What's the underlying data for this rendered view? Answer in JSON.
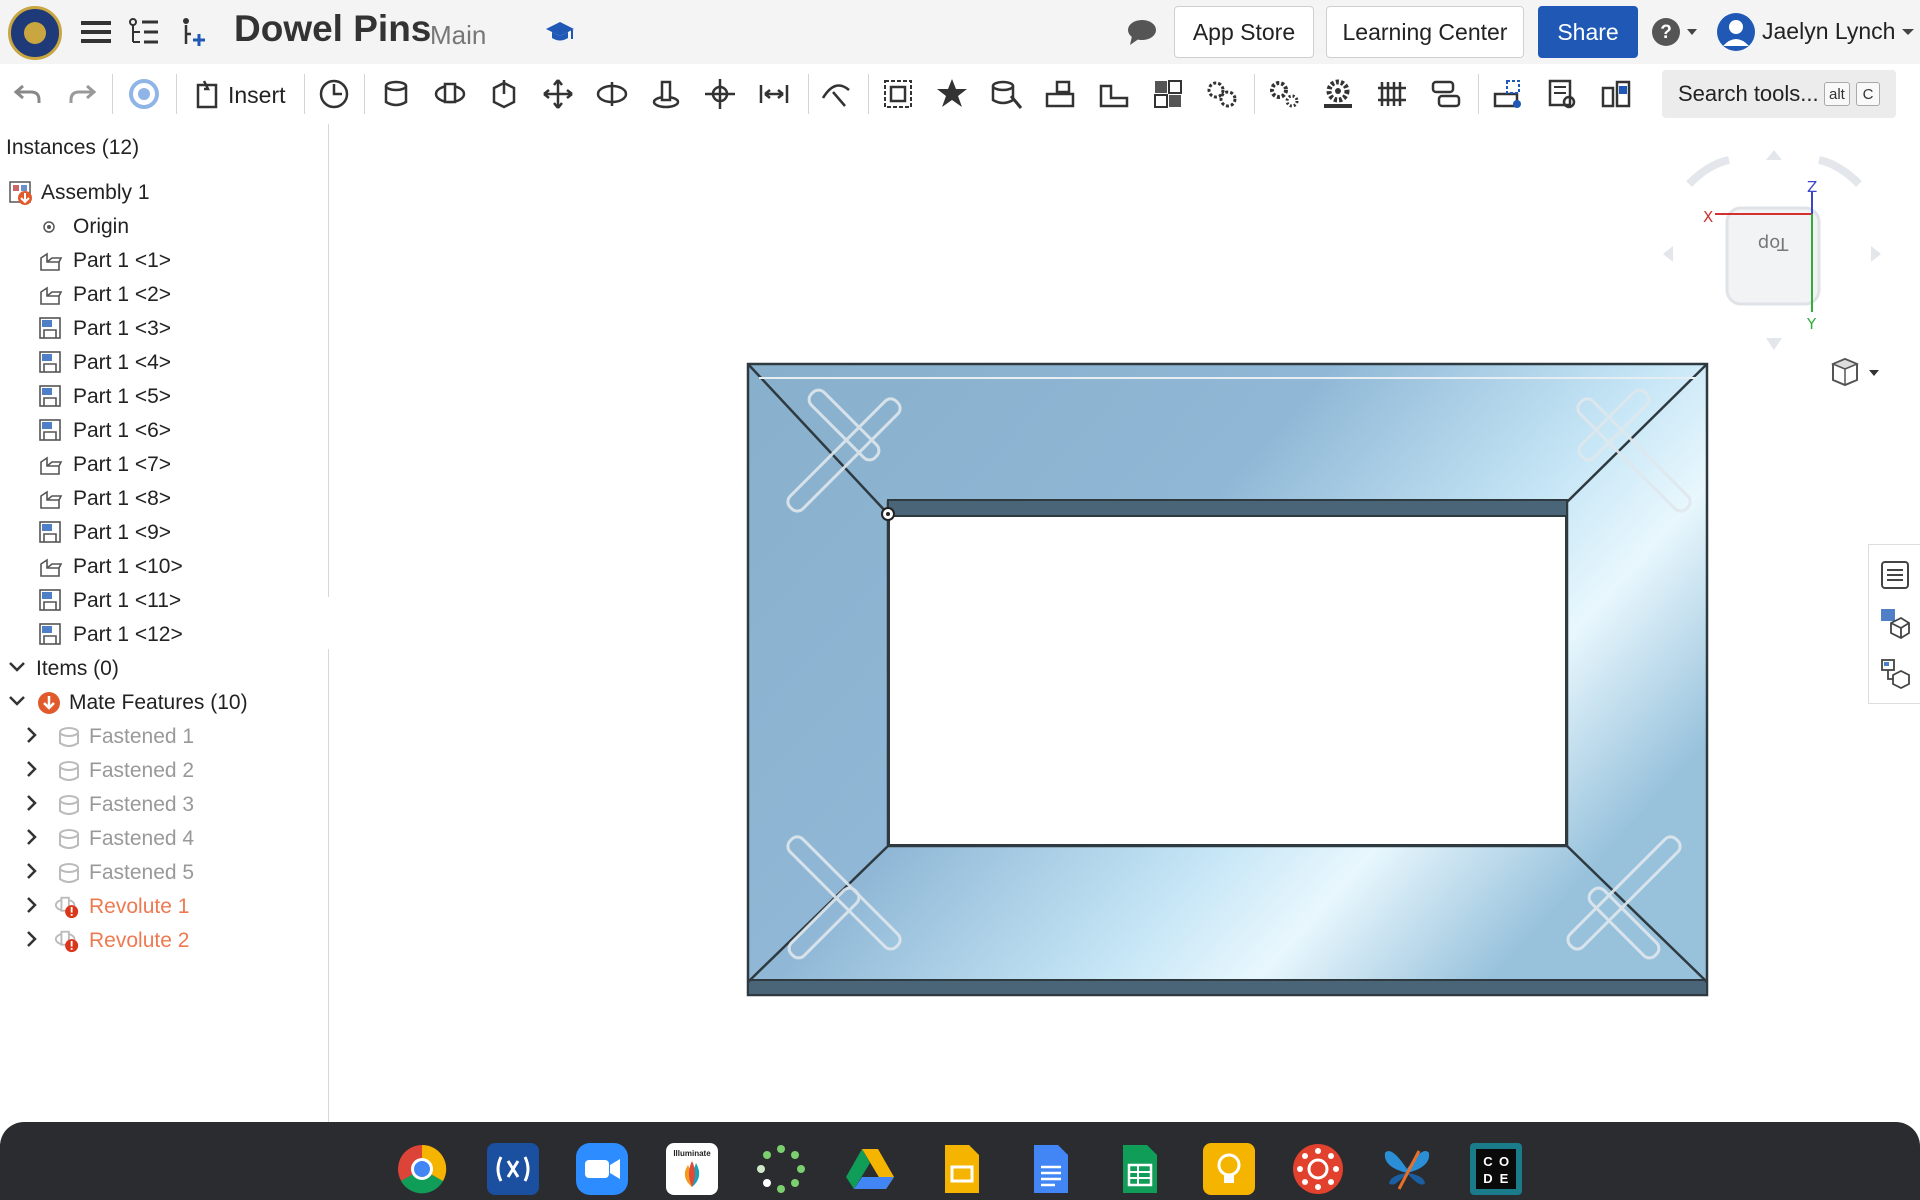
{
  "header": {
    "title": "Dowel Pins",
    "branch": "Main",
    "app_store_label": "App Store",
    "learning_center_label": "Learning Center",
    "share_label": "Share",
    "user_name": "Jaelyn Lynch"
  },
  "toolbar": {
    "insert_label": "Insert",
    "search_label": "Search tools...",
    "search_shortcut_mod": "alt",
    "search_shortcut_key": "C"
  },
  "instances_panel": {
    "title": "Instances (12)",
    "assembly": "Assembly 1",
    "origin": "Origin",
    "parts": [
      "Part 1 <1>",
      "Part 1 <2>",
      "Part 1 <3>",
      "Part 1 <4>",
      "Part 1 <5>",
      "Part 1 <6>",
      "Part 1 <7>",
      "Part 1 <8>",
      "Part 1 <9>",
      "Part 1 <10>",
      "Part 1 <11>",
      "Part 1 <12>"
    ],
    "items_group": "Items (0)",
    "mate_features_group": "Mate Features (10)",
    "mates": [
      {
        "label": "Fastened 1",
        "state": "suppressed"
      },
      {
        "label": "Fastened 2",
        "state": "suppressed"
      },
      {
        "label": "Fastened 3",
        "state": "suppressed"
      },
      {
        "label": "Fastened 4",
        "state": "suppressed"
      },
      {
        "label": "Fastened 5",
        "state": "suppressed"
      },
      {
        "label": "Revolute 1",
        "state": "error"
      },
      {
        "label": "Revolute 2",
        "state": "error"
      }
    ]
  },
  "view_cube": {
    "face_label": "Top",
    "axis_x": "X",
    "axis_y": "Y",
    "axis_z": "Z"
  },
  "colors": {
    "accent": "#1f58b5",
    "frame_fill": "#8ab2cf",
    "frame_edge": "#3f5a6b",
    "error": "#e05a2b",
    "taskbar": "#2b2c30"
  },
  "taskbar": {
    "apps": [
      "chrome-icon",
      "parentsquare-icon",
      "zoom-icon",
      "illuminate-icon",
      "loading-dots-icon",
      "google-drive-icon",
      "google-slides-icon",
      "google-docs-icon",
      "google-sheets-icon",
      "google-keep-icon",
      "canvas-icon",
      "butterfly-app-icon",
      "code-org-icon"
    ],
    "illuminate_label": "Illuminate",
    "code_label": "CODE"
  }
}
